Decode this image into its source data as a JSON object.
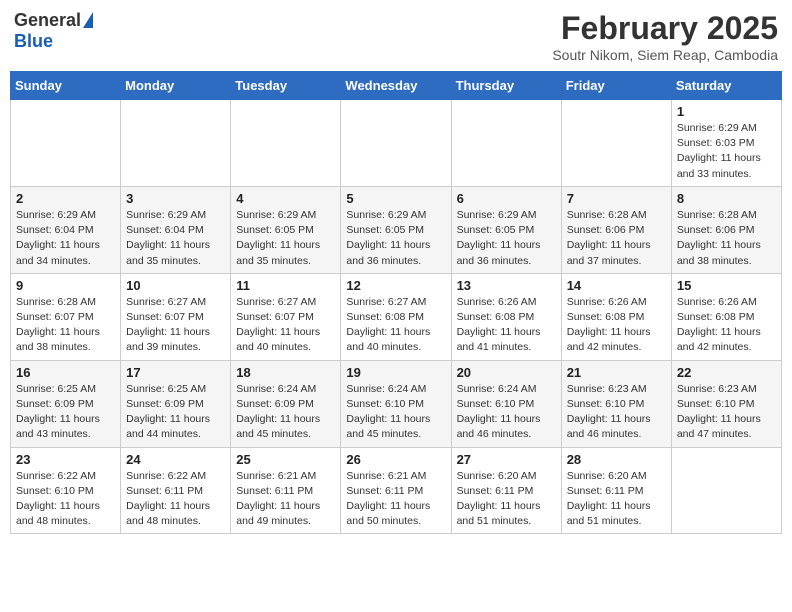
{
  "header": {
    "logo_general": "General",
    "logo_blue": "Blue",
    "month_title": "February 2025",
    "location": "Soutr Nikom, Siem Reap, Cambodia"
  },
  "days_of_week": [
    "Sunday",
    "Monday",
    "Tuesday",
    "Wednesday",
    "Thursday",
    "Friday",
    "Saturday"
  ],
  "weeks": [
    [
      {
        "day": "",
        "info": ""
      },
      {
        "day": "",
        "info": ""
      },
      {
        "day": "",
        "info": ""
      },
      {
        "day": "",
        "info": ""
      },
      {
        "day": "",
        "info": ""
      },
      {
        "day": "",
        "info": ""
      },
      {
        "day": "1",
        "info": "Sunrise: 6:29 AM\nSunset: 6:03 PM\nDaylight: 11 hours\nand 33 minutes."
      }
    ],
    [
      {
        "day": "2",
        "info": "Sunrise: 6:29 AM\nSunset: 6:04 PM\nDaylight: 11 hours\nand 34 minutes."
      },
      {
        "day": "3",
        "info": "Sunrise: 6:29 AM\nSunset: 6:04 PM\nDaylight: 11 hours\nand 35 minutes."
      },
      {
        "day": "4",
        "info": "Sunrise: 6:29 AM\nSunset: 6:05 PM\nDaylight: 11 hours\nand 35 minutes."
      },
      {
        "day": "5",
        "info": "Sunrise: 6:29 AM\nSunset: 6:05 PM\nDaylight: 11 hours\nand 36 minutes."
      },
      {
        "day": "6",
        "info": "Sunrise: 6:29 AM\nSunset: 6:05 PM\nDaylight: 11 hours\nand 36 minutes."
      },
      {
        "day": "7",
        "info": "Sunrise: 6:28 AM\nSunset: 6:06 PM\nDaylight: 11 hours\nand 37 minutes."
      },
      {
        "day": "8",
        "info": "Sunrise: 6:28 AM\nSunset: 6:06 PM\nDaylight: 11 hours\nand 38 minutes."
      }
    ],
    [
      {
        "day": "9",
        "info": "Sunrise: 6:28 AM\nSunset: 6:07 PM\nDaylight: 11 hours\nand 38 minutes."
      },
      {
        "day": "10",
        "info": "Sunrise: 6:27 AM\nSunset: 6:07 PM\nDaylight: 11 hours\nand 39 minutes."
      },
      {
        "day": "11",
        "info": "Sunrise: 6:27 AM\nSunset: 6:07 PM\nDaylight: 11 hours\nand 40 minutes."
      },
      {
        "day": "12",
        "info": "Sunrise: 6:27 AM\nSunset: 6:08 PM\nDaylight: 11 hours\nand 40 minutes."
      },
      {
        "day": "13",
        "info": "Sunrise: 6:26 AM\nSunset: 6:08 PM\nDaylight: 11 hours\nand 41 minutes."
      },
      {
        "day": "14",
        "info": "Sunrise: 6:26 AM\nSunset: 6:08 PM\nDaylight: 11 hours\nand 42 minutes."
      },
      {
        "day": "15",
        "info": "Sunrise: 6:26 AM\nSunset: 6:08 PM\nDaylight: 11 hours\nand 42 minutes."
      }
    ],
    [
      {
        "day": "16",
        "info": "Sunrise: 6:25 AM\nSunset: 6:09 PM\nDaylight: 11 hours\nand 43 minutes."
      },
      {
        "day": "17",
        "info": "Sunrise: 6:25 AM\nSunset: 6:09 PM\nDaylight: 11 hours\nand 44 minutes."
      },
      {
        "day": "18",
        "info": "Sunrise: 6:24 AM\nSunset: 6:09 PM\nDaylight: 11 hours\nand 45 minutes."
      },
      {
        "day": "19",
        "info": "Sunrise: 6:24 AM\nSunset: 6:10 PM\nDaylight: 11 hours\nand 45 minutes."
      },
      {
        "day": "20",
        "info": "Sunrise: 6:24 AM\nSunset: 6:10 PM\nDaylight: 11 hours\nand 46 minutes."
      },
      {
        "day": "21",
        "info": "Sunrise: 6:23 AM\nSunset: 6:10 PM\nDaylight: 11 hours\nand 46 minutes."
      },
      {
        "day": "22",
        "info": "Sunrise: 6:23 AM\nSunset: 6:10 PM\nDaylight: 11 hours\nand 47 minutes."
      }
    ],
    [
      {
        "day": "23",
        "info": "Sunrise: 6:22 AM\nSunset: 6:10 PM\nDaylight: 11 hours\nand 48 minutes."
      },
      {
        "day": "24",
        "info": "Sunrise: 6:22 AM\nSunset: 6:11 PM\nDaylight: 11 hours\nand 48 minutes."
      },
      {
        "day": "25",
        "info": "Sunrise: 6:21 AM\nSunset: 6:11 PM\nDaylight: 11 hours\nand 49 minutes."
      },
      {
        "day": "26",
        "info": "Sunrise: 6:21 AM\nSunset: 6:11 PM\nDaylight: 11 hours\nand 50 minutes."
      },
      {
        "day": "27",
        "info": "Sunrise: 6:20 AM\nSunset: 6:11 PM\nDaylight: 11 hours\nand 51 minutes."
      },
      {
        "day": "28",
        "info": "Sunrise: 6:20 AM\nSunset: 6:11 PM\nDaylight: 11 hours\nand 51 minutes."
      },
      {
        "day": "",
        "info": ""
      }
    ]
  ]
}
